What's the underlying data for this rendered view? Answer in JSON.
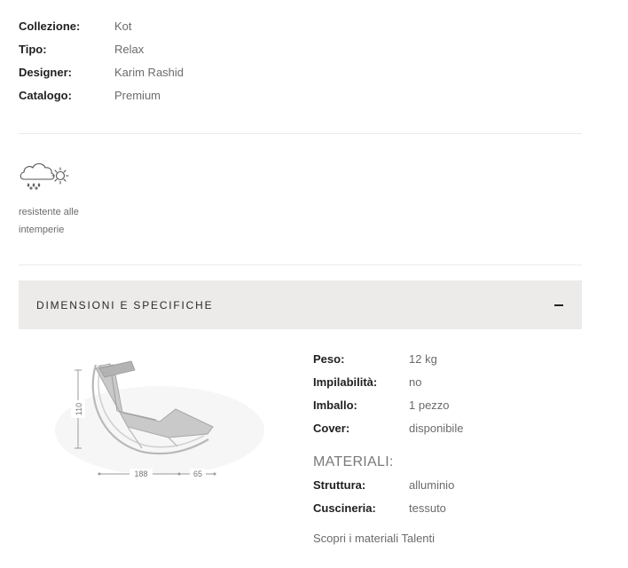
{
  "specs": [
    {
      "key": "Collezione:",
      "value": "Kot"
    },
    {
      "key": "Tipo:",
      "value": "Relax"
    },
    {
      "key": "Designer:",
      "value": "Karim Rashid"
    },
    {
      "key": "Catalogo:",
      "value": "Premium"
    }
  ],
  "feature": {
    "icon": "weather-resistant-icon",
    "label": "resistente alle intemperie"
  },
  "accordion": {
    "title": "DIMENSIONI E SPECIFICHE",
    "toggle_icon": "minus-icon"
  },
  "drawing": {
    "height_label": "110",
    "length_label": "188",
    "extra_label": "65"
  },
  "details": [
    {
      "key": "Peso:",
      "value": "12 kg"
    },
    {
      "key": "Impilabilità:",
      "value": "no"
    },
    {
      "key": "Imballo:",
      "value": "1 pezzo"
    },
    {
      "key": "Cover:",
      "value": "disponibile"
    }
  ],
  "materials": {
    "heading": "MATERIALI:",
    "rows": [
      {
        "key": "Struttura:",
        "value": "alluminio"
      },
      {
        "key": "Cuscineria:",
        "value": "tessuto"
      }
    ],
    "link": "Scopri i materiali Talenti"
  }
}
